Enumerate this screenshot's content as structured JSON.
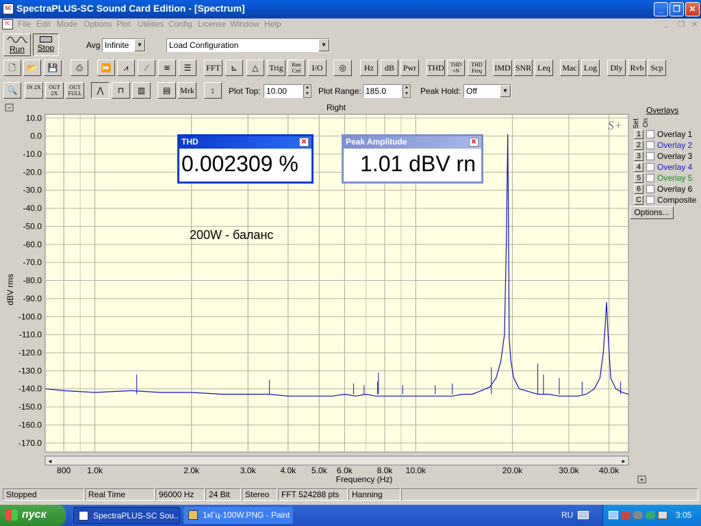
{
  "window": {
    "title": "SpectraPLUS-SC Sound Card Edition - [Spectrum]",
    "app_icon_text": "SC",
    "minimize": "_",
    "maximize": "❐",
    "close": "✕"
  },
  "menu": [
    "File",
    "Edit",
    "Mode",
    "Options",
    "Plot",
    "Utilities",
    "Config",
    "License",
    "Window",
    "Help"
  ],
  "mdi_buttons": [
    "_",
    "❐",
    "✕"
  ],
  "toolbar1": {
    "run": "Run",
    "stop": "Stop",
    "avg_label": "Avg",
    "avg_value": "Infinite",
    "config_value": "Load Configuration"
  },
  "toolbar2": {
    "buttons": [
      "FFT",
      "Trig",
      "Run Ctrl",
      "I/O",
      "Hz",
      "dB",
      "Pwr",
      "THD",
      "THD +N",
      "THD Freq",
      "IMD",
      "SNR",
      "Leq",
      "Mac",
      "Log",
      "Dly",
      "Rvb",
      "Scp"
    ]
  },
  "toolbar3": {
    "zoom_buttons": [
      "IN 2X",
      "OUT 2X",
      "OUT FULL"
    ],
    "mrk": "Mrk",
    "plot_top_label": "Plot Top:",
    "plot_top_value": "10.00",
    "plot_range_label": "Plot Range:",
    "plot_range_value": "185.0",
    "peak_hold_label": "Peak Hold:",
    "peak_hold_value": "Off"
  },
  "plot": {
    "channel_title": "Right",
    "collapse_btn": "−",
    "expand_btn": "+",
    "logo": "S+",
    "annotation": "200W - баланс"
  },
  "thd_panel": {
    "title": "THD",
    "value": "0.002309 %"
  },
  "peak_panel": {
    "title": "Peak Amplitude",
    "value": "1.01 dBV rn"
  },
  "overlays": {
    "title": "Overlays",
    "set_label": "Set",
    "on_label": "On",
    "items": [
      {
        "num": "1",
        "label": "Overlay 1",
        "color": "#000000"
      },
      {
        "num": "2",
        "label": "Overlay 2",
        "color": "#1a1acc"
      },
      {
        "num": "3",
        "label": "Overlay 3",
        "color": "#000000"
      },
      {
        "num": "4",
        "label": "Overlay 4",
        "color": "#1a1acc"
      },
      {
        "num": "5",
        "label": "Overlay 5",
        "color": "#1a8a1a"
      },
      {
        "num": "6",
        "label": "Overlay 6",
        "color": "#000000"
      },
      {
        "num": "C",
        "label": "Composite",
        "color": "#000000"
      }
    ],
    "options_button": "Options..."
  },
  "status": [
    "Stopped",
    "Real Time",
    "96000 Hz",
    "24 Bit",
    "Stereo",
    "FFT 524288 pts",
    "Hanning"
  ],
  "taskbar": {
    "start": "пуск",
    "tasks": [
      "SpectraPLUS-SC Sou...",
      "1кГц-100W.PNG - Paint"
    ],
    "lang": "RU",
    "clock": "3:05"
  },
  "colors": {
    "trace": "#1010c0",
    "plot_bg": "#ffffe1",
    "grid": "#b0b0a0",
    "title_bar": "#0a5fe0"
  },
  "chart_data": {
    "type": "line",
    "xlabel": "Frequency (Hz)",
    "ylabel": "dBV rms",
    "x_scale": "log",
    "xlim": [
      700,
      46000
    ],
    "ylim": [
      -175,
      12
    ],
    "y_ticks": [
      10.0,
      0.0,
      -10.0,
      -20.0,
      -30.0,
      -40.0,
      -50.0,
      -60.0,
      -70.0,
      -80.0,
      -90.0,
      -100.0,
      -110.0,
      -120.0,
      -130.0,
      -140.0,
      -150.0,
      -160.0,
      -170.0
    ],
    "x_ticks": [
      {
        "value": 800,
        "label": "800"
      },
      {
        "value": 1000,
        "label": "1.0k"
      },
      {
        "value": 2000,
        "label": "2.0k"
      },
      {
        "value": 3000,
        "label": "3.0k"
      },
      {
        "value": 4000,
        "label": "4.0k"
      },
      {
        "value": 5000,
        "label": "5.0k"
      },
      {
        "value": 6000,
        "label": "6.0k"
      },
      {
        "value": 8000,
        "label": "8.0k"
      },
      {
        "value": 10000,
        "label": "10.0k"
      },
      {
        "value": 20000,
        "label": "20.0k"
      },
      {
        "value": 30000,
        "label": "30.0k"
      },
      {
        "value": 40000,
        "label": "40.0k"
      }
    ],
    "grid": true,
    "series": [
      {
        "x": [
          700,
          800,
          1000,
          1300,
          1600,
          2000,
          2500,
          3000,
          3500,
          4000,
          4500,
          5000,
          5500,
          6000,
          6500,
          7000,
          7500,
          8000,
          9000,
          10000,
          11000,
          12000,
          13000,
          14000,
          15000,
          16000,
          17000,
          17800,
          18400,
          18900,
          19150,
          19350,
          19450,
          19550,
          19800,
          20200,
          21000,
          22000,
          24000,
          26000,
          28000,
          30000,
          32000,
          34000,
          36000,
          37500,
          38400,
          38900,
          39300,
          39700,
          40500,
          42000,
          44000,
          46000
        ],
        "y": [
          -140,
          -141,
          -142,
          -141,
          -142,
          -142,
          -143,
          -143,
          -143,
          -144,
          -144,
          -144,
          -144,
          -143,
          -144,
          -143,
          -144,
          -144,
          -144,
          -144,
          -144,
          -144,
          -144,
          -143,
          -143,
          -141,
          -139,
          -134,
          -125,
          -110,
          -60,
          1,
          -50,
          -112,
          -125,
          -134,
          -140,
          -141,
          -143,
          -143,
          -144,
          -144,
          -144,
          -143,
          -140,
          -134,
          -120,
          -106,
          -92,
          -108,
          -134,
          -140,
          -142,
          -143
        ]
      }
    ],
    "spikes": [
      {
        "x": 1350,
        "y": -132
      },
      {
        "x": 3500,
        "y": -135
      },
      {
        "x": 6400,
        "y": -137
      },
      {
        "x": 6900,
        "y": -138
      },
      {
        "x": 7600,
        "y": -136
      },
      {
        "x": 7650,
        "y": -131
      },
      {
        "x": 9100,
        "y": -138
      },
      {
        "x": 11500,
        "y": -138
      },
      {
        "x": 13000,
        "y": -137
      },
      {
        "x": 17200,
        "y": -128
      },
      {
        "x": 24000,
        "y": -126
      },
      {
        "x": 25000,
        "y": -132
      },
      {
        "x": 28000,
        "y": -134
      },
      {
        "x": 33000,
        "y": -136
      },
      {
        "x": 43500,
        "y": -136
      }
    ]
  }
}
